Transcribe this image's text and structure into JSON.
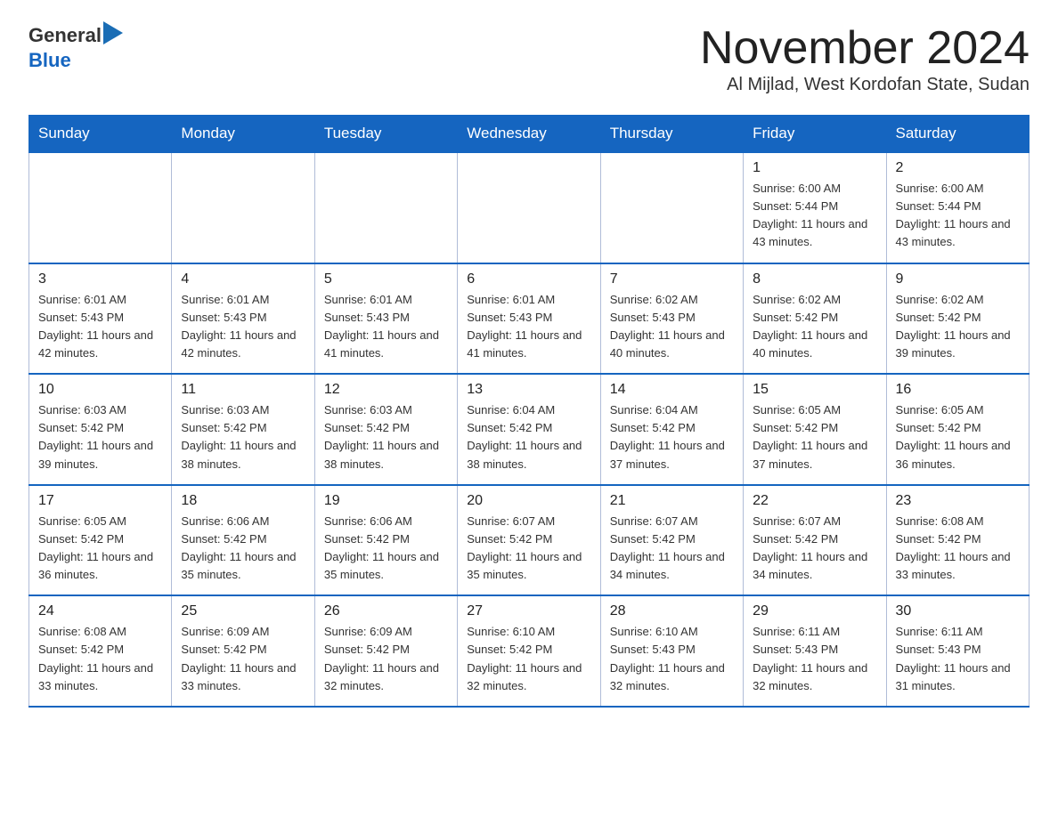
{
  "header": {
    "logo_general": "General",
    "logo_blue": "Blue",
    "month_title": "November 2024",
    "subtitle": "Al Mijlad, West Kordofan State, Sudan"
  },
  "weekdays": [
    "Sunday",
    "Monday",
    "Tuesday",
    "Wednesday",
    "Thursday",
    "Friday",
    "Saturday"
  ],
  "weeks": [
    [
      {
        "day": "",
        "info": ""
      },
      {
        "day": "",
        "info": ""
      },
      {
        "day": "",
        "info": ""
      },
      {
        "day": "",
        "info": ""
      },
      {
        "day": "",
        "info": ""
      },
      {
        "day": "1",
        "info": "Sunrise: 6:00 AM\nSunset: 5:44 PM\nDaylight: 11 hours and 43 minutes."
      },
      {
        "day": "2",
        "info": "Sunrise: 6:00 AM\nSunset: 5:44 PM\nDaylight: 11 hours and 43 minutes."
      }
    ],
    [
      {
        "day": "3",
        "info": "Sunrise: 6:01 AM\nSunset: 5:43 PM\nDaylight: 11 hours and 42 minutes."
      },
      {
        "day": "4",
        "info": "Sunrise: 6:01 AM\nSunset: 5:43 PM\nDaylight: 11 hours and 42 minutes."
      },
      {
        "day": "5",
        "info": "Sunrise: 6:01 AM\nSunset: 5:43 PM\nDaylight: 11 hours and 41 minutes."
      },
      {
        "day": "6",
        "info": "Sunrise: 6:01 AM\nSunset: 5:43 PM\nDaylight: 11 hours and 41 minutes."
      },
      {
        "day": "7",
        "info": "Sunrise: 6:02 AM\nSunset: 5:43 PM\nDaylight: 11 hours and 40 minutes."
      },
      {
        "day": "8",
        "info": "Sunrise: 6:02 AM\nSunset: 5:42 PM\nDaylight: 11 hours and 40 minutes."
      },
      {
        "day": "9",
        "info": "Sunrise: 6:02 AM\nSunset: 5:42 PM\nDaylight: 11 hours and 39 minutes."
      }
    ],
    [
      {
        "day": "10",
        "info": "Sunrise: 6:03 AM\nSunset: 5:42 PM\nDaylight: 11 hours and 39 minutes."
      },
      {
        "day": "11",
        "info": "Sunrise: 6:03 AM\nSunset: 5:42 PM\nDaylight: 11 hours and 38 minutes."
      },
      {
        "day": "12",
        "info": "Sunrise: 6:03 AM\nSunset: 5:42 PM\nDaylight: 11 hours and 38 minutes."
      },
      {
        "day": "13",
        "info": "Sunrise: 6:04 AM\nSunset: 5:42 PM\nDaylight: 11 hours and 38 minutes."
      },
      {
        "day": "14",
        "info": "Sunrise: 6:04 AM\nSunset: 5:42 PM\nDaylight: 11 hours and 37 minutes."
      },
      {
        "day": "15",
        "info": "Sunrise: 6:05 AM\nSunset: 5:42 PM\nDaylight: 11 hours and 37 minutes."
      },
      {
        "day": "16",
        "info": "Sunrise: 6:05 AM\nSunset: 5:42 PM\nDaylight: 11 hours and 36 minutes."
      }
    ],
    [
      {
        "day": "17",
        "info": "Sunrise: 6:05 AM\nSunset: 5:42 PM\nDaylight: 11 hours and 36 minutes."
      },
      {
        "day": "18",
        "info": "Sunrise: 6:06 AM\nSunset: 5:42 PM\nDaylight: 11 hours and 35 minutes."
      },
      {
        "day": "19",
        "info": "Sunrise: 6:06 AM\nSunset: 5:42 PM\nDaylight: 11 hours and 35 minutes."
      },
      {
        "day": "20",
        "info": "Sunrise: 6:07 AM\nSunset: 5:42 PM\nDaylight: 11 hours and 35 minutes."
      },
      {
        "day": "21",
        "info": "Sunrise: 6:07 AM\nSunset: 5:42 PM\nDaylight: 11 hours and 34 minutes."
      },
      {
        "day": "22",
        "info": "Sunrise: 6:07 AM\nSunset: 5:42 PM\nDaylight: 11 hours and 34 minutes."
      },
      {
        "day": "23",
        "info": "Sunrise: 6:08 AM\nSunset: 5:42 PM\nDaylight: 11 hours and 33 minutes."
      }
    ],
    [
      {
        "day": "24",
        "info": "Sunrise: 6:08 AM\nSunset: 5:42 PM\nDaylight: 11 hours and 33 minutes."
      },
      {
        "day": "25",
        "info": "Sunrise: 6:09 AM\nSunset: 5:42 PM\nDaylight: 11 hours and 33 minutes."
      },
      {
        "day": "26",
        "info": "Sunrise: 6:09 AM\nSunset: 5:42 PM\nDaylight: 11 hours and 32 minutes."
      },
      {
        "day": "27",
        "info": "Sunrise: 6:10 AM\nSunset: 5:42 PM\nDaylight: 11 hours and 32 minutes."
      },
      {
        "day": "28",
        "info": "Sunrise: 6:10 AM\nSunset: 5:43 PM\nDaylight: 11 hours and 32 minutes."
      },
      {
        "day": "29",
        "info": "Sunrise: 6:11 AM\nSunset: 5:43 PM\nDaylight: 11 hours and 32 minutes."
      },
      {
        "day": "30",
        "info": "Sunrise: 6:11 AM\nSunset: 5:43 PM\nDaylight: 11 hours and 31 minutes."
      }
    ]
  ]
}
